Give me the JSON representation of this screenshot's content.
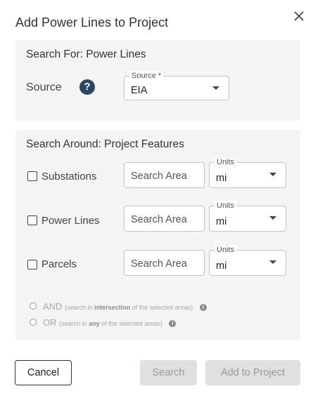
{
  "dialog": {
    "title": "Add Power Lines to Project",
    "close_icon": "close-icon"
  },
  "search_for": {
    "title": "Search For: Power Lines",
    "source_label": "Source",
    "help_icon_text": "?",
    "source_field": {
      "label": "Source *",
      "value": "EIA"
    }
  },
  "search_around": {
    "title": "Search Around: Project Features",
    "rows": [
      {
        "label": "Substations",
        "checked": false,
        "area_placeholder": "Search Area",
        "units_label": "Units",
        "units_value": "mi"
      },
      {
        "label": "Power Lines",
        "checked": false,
        "area_placeholder": "Search Area",
        "units_label": "Units",
        "units_value": "mi"
      },
      {
        "label": "Parcels",
        "checked": false,
        "area_placeholder": "Search Area",
        "units_label": "Units",
        "units_value": "mi"
      }
    ],
    "logic": {
      "and": {
        "label": "AND",
        "hint_pre": "(search in ",
        "hint_bold": "intersection",
        "hint_post": " of the selected areas)",
        "info_text": "i"
      },
      "or": {
        "label": "OR",
        "hint_pre": "(search in ",
        "hint_bold": "any",
        "hint_post": " of the selected areas)",
        "info_text": "i"
      }
    }
  },
  "footer": {
    "cancel": "Cancel",
    "search": "Search",
    "add": "Add to Project"
  },
  "colors": {
    "panel_bg": "#f4f4f4",
    "help_icon_bg": "#2b4660",
    "disabled_button_bg": "#e0e0e0",
    "disabled_text": "#9a9a9a"
  }
}
